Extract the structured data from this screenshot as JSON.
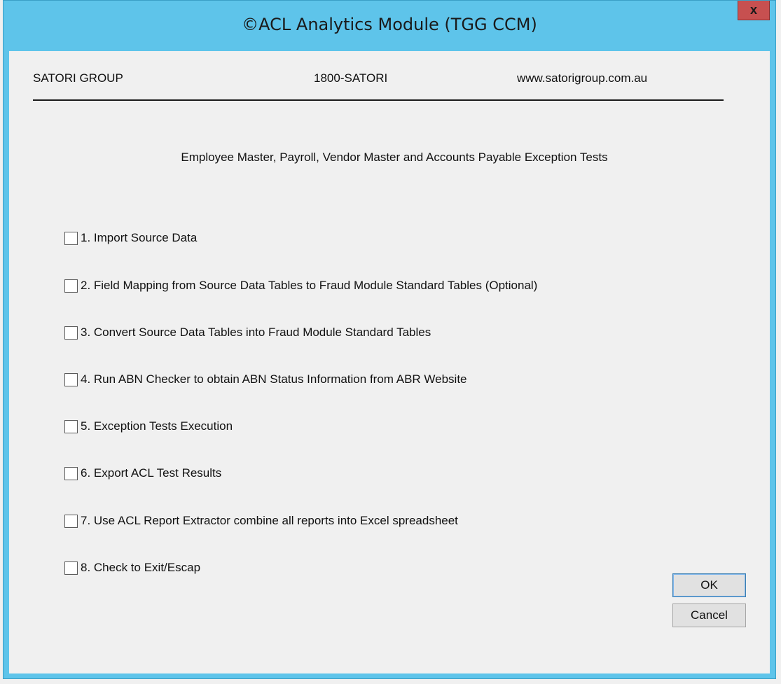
{
  "window": {
    "title": "©ACL Analytics Module (TGG CCM)",
    "close_label": "x"
  },
  "header": {
    "company": "SATORI GROUP",
    "phone": "1800-SATORI",
    "website": "www.satorigroup.com.au"
  },
  "subtitle": "Employee Master, Payroll, Vendor Master and Accounts Payable Exception Tests",
  "options": [
    {
      "label": "1. Import Source Data",
      "checked": false
    },
    {
      "label": "2. Field Mapping from Source Data Tables to Fraud Module Standard Tables (Optional)",
      "checked": false
    },
    {
      "label": "3. Convert Source Data Tables into Fraud Module  Standard Tables",
      "checked": false
    },
    {
      "label": "4. Run ABN Checker to obtain ABN Status Information from ABR Website",
      "checked": false
    },
    {
      "label": "5. Exception Tests Execution",
      "checked": false
    },
    {
      "label": "6. Export ACL Test Results",
      "checked": false
    },
    {
      "label": "7. Use ACL Report Extractor combine all reports into Excel spreadsheet",
      "checked": false
    },
    {
      "label": "8. Check to Exit/Escap",
      "checked": false
    }
  ],
  "buttons": {
    "ok": "OK",
    "cancel": "Cancel"
  },
  "colors": {
    "titlebar": "#5ec4ea",
    "close_button": "#c75050",
    "client_background": "#f0f0f0"
  }
}
